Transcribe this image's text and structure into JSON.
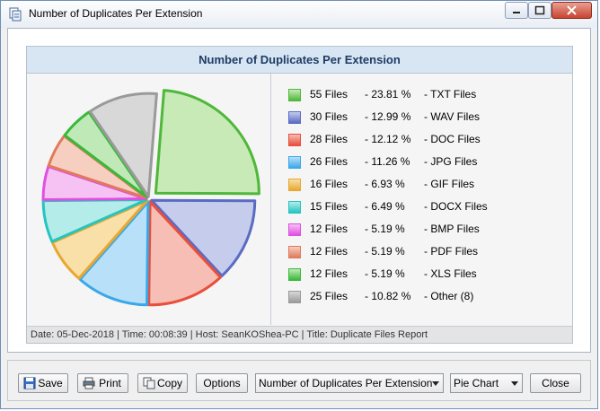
{
  "window": {
    "title": "Number of Duplicates Per Extension"
  },
  "chart_data": {
    "type": "pie",
    "title": "Number of Duplicates Per Extension",
    "slices": [
      {
        "files": "55 Files",
        "percent": "- 23.81 %",
        "label": "- TXT Files",
        "value": 55,
        "color": "#4fb83a",
        "fill": "#c8eab7"
      },
      {
        "files": "30 Files",
        "percent": "- 12.99 %",
        "label": "- WAV Files",
        "value": 30,
        "color": "#5a6bc4",
        "fill": "#c6cceb"
      },
      {
        "files": "28 Files",
        "percent": "- 12.12 %",
        "label": "- DOC Files",
        "value": 28,
        "color": "#e84f3c",
        "fill": "#f6beb4"
      },
      {
        "files": "26 Files",
        "percent": "- 11.26 %",
        "label": "- JPG Files",
        "value": 26,
        "color": "#3aa8e8",
        "fill": "#b8e0f8"
      },
      {
        "files": "16 Files",
        "percent": "- 6.93 %",
        "label": "- GIF Files",
        "value": 16,
        "color": "#e8a830",
        "fill": "#f9dfa8"
      },
      {
        "files": "15 Files",
        "percent": "- 6.49 %",
        "label": "- DOCX Files",
        "value": 15,
        "color": "#26c4c0",
        "fill": "#b4ecea"
      },
      {
        "files": "12 Files",
        "percent": "- 5.19 %",
        "label": "- BMP Files",
        "value": 12,
        "color": "#e050e0",
        "fill": "#f6c2f4"
      },
      {
        "files": "12 Files",
        "percent": "- 5.19 %",
        "label": "- PDF Files",
        "value": 12,
        "color": "#e07a5c",
        "fill": "#f6cfc0"
      },
      {
        "files": "12 Files",
        "percent": "- 5.19 %",
        "label": "- XLS Files",
        "value": 12,
        "color": "#3ab83a",
        "fill": "#bfeab8"
      },
      {
        "files": "25 Files",
        "percent": "- 10.82 %",
        "label": "- Other (8)",
        "value": 25,
        "color": "#9a9a9a",
        "fill": "#d8d8d8"
      }
    ],
    "exploded": "TXT Files"
  },
  "footer": {
    "text": "Date: 05-Dec-2018 | Time: 00:08:39 | Host: SeanKOShea-PC | Title: Duplicate Files Report"
  },
  "toolbar": {
    "save": "Save",
    "print": "Print",
    "copy": "Copy",
    "options": "Options",
    "report_select": "Number of Duplicates Per Extension",
    "chart_type_select": "Pie Chart",
    "close": "Close"
  }
}
